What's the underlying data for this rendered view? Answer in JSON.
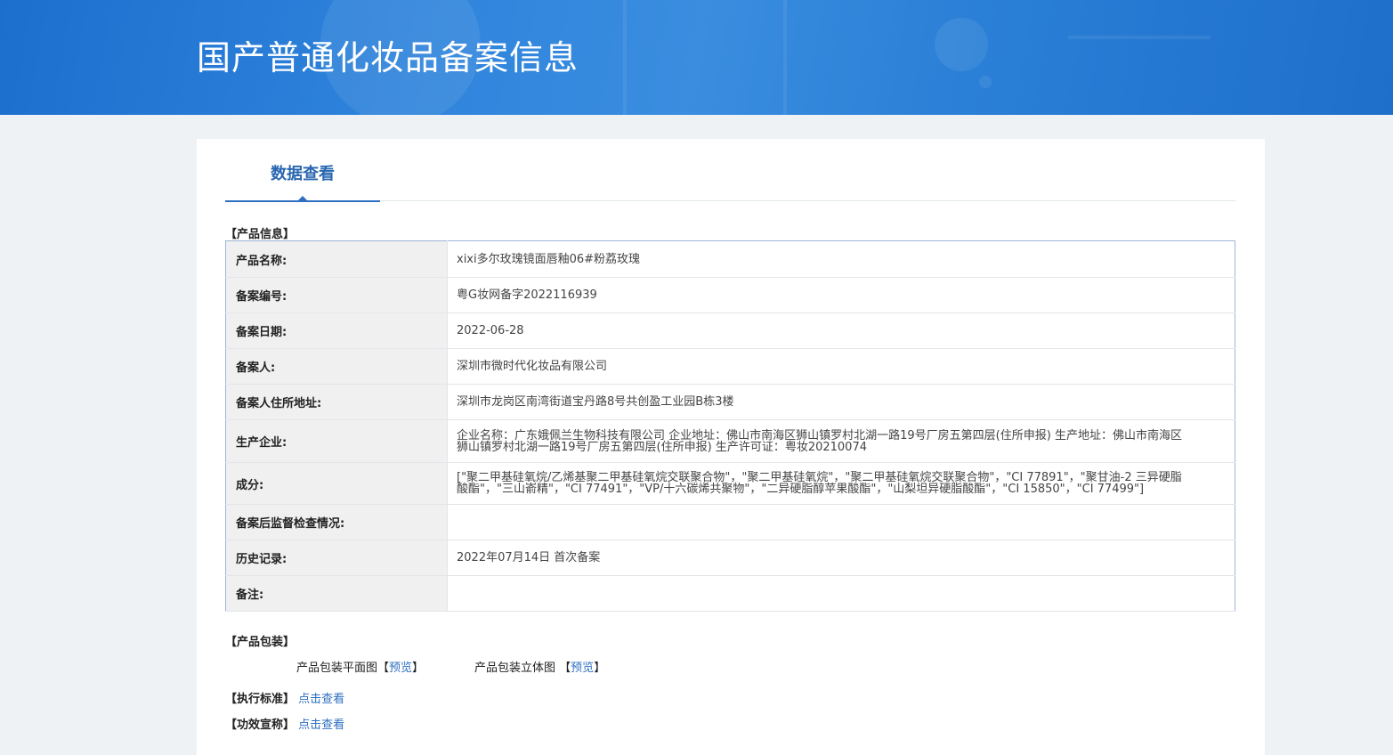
{
  "header": {
    "title": "国产普通化妆品备案信息"
  },
  "tabs": [
    {
      "label": "数据查看"
    }
  ],
  "sections": {
    "product_info": "【产品信息】",
    "packaging": "【产品包装】",
    "standard": "【执行标准】",
    "efficacy": "【功效宣称】"
  },
  "product_info": [
    {
      "label": "产品名称:",
      "value": "xixi多尔玫瑰镜面唇釉06#粉荔玫瑰"
    },
    {
      "label": "备案编号:",
      "value": "粤G妆网备字2022116939"
    },
    {
      "label": "备案日期:",
      "value": "2022-06-28"
    },
    {
      "label": "备案人:",
      "value": "深圳市微时代化妆品有限公司"
    },
    {
      "label": "备案人住所地址:",
      "value": "深圳市龙岗区南湾街道宝丹路8号共创盈工业园B栋3楼"
    },
    {
      "label": "生产企业:",
      "value": "企业名称：广东娥佩兰生物科技有限公司 企业地址：佛山市南海区狮山镇罗村北湖一路19号厂房五第四层(住所申报) 生产地址：佛山市南海区狮山镇罗村北湖一路19号厂房五第四层(住所申报) 生产许可证：粤妆20210074"
    },
    {
      "label": "成分:",
      "value": "[\"聚二甲基硅氧烷/乙烯基聚二甲基硅氧烷交联聚合物\"，\"聚二甲基硅氧烷\"，\"聚二甲基硅氧烷交联聚合物\"，\"CI 77891\"，\"聚甘油-2 三异硬脂酸酯\"，\"三山嵛精\"，\"CI 77491\"，\"VP/十六碳烯共聚物\"，\"二异硬脂醇苹果酸酯\"，\"山梨坦异硬脂酸酯\"，\"CI 15850\"，\"CI 77499\"]"
    },
    {
      "label": "备案后监督检查情况:",
      "value": ""
    },
    {
      "label": "历史记录:",
      "value": "2022年07月14日 首次备案"
    },
    {
      "label": "备注:",
      "value": ""
    }
  ],
  "packaging": {
    "flat_label": "产品包装平面图",
    "solid_label": "产品包装立体图",
    "open_bracket": "【",
    "close_bracket": "】",
    "preview": "预览"
  },
  "standard": {
    "link": "点击查看"
  },
  "efficacy": {
    "link": "点击查看"
  }
}
